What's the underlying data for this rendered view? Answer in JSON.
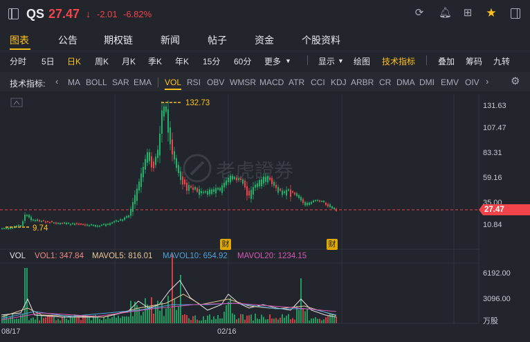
{
  "header": {
    "ticker": "QS",
    "price": "27.47",
    "arrow": "↓",
    "change": "-2.01",
    "change_pct": "-6.82%",
    "icons": [
      "refresh-icon",
      "bell-icon",
      "grid-icon",
      "star-icon",
      "sidebar-icon"
    ]
  },
  "tabs": [
    "图表",
    "公告",
    "期权链",
    "新闻",
    "帖子",
    "资金",
    "个股资料"
  ],
  "periods": [
    "分时",
    "5日",
    "日K",
    "周K",
    "月K",
    "季K",
    "年K",
    "15分",
    "60分",
    "更多"
  ],
  "tools": [
    "显示",
    "绘图",
    "技术指标",
    "叠加",
    "筹码",
    "九转"
  ],
  "indicator_bar": {
    "label": "技术指标:",
    "items": [
      "MA",
      "BOLL",
      "SAR",
      "EMA",
      "VOL",
      "RSI",
      "OBV",
      "WMSR",
      "MACD",
      "ATR",
      "CCI",
      "KDJ",
      "ARBR",
      "CR",
      "DMA",
      "DMI",
      "EMV",
      "OIV"
    ]
  },
  "price_axis": [
    "131.63",
    "107.47",
    "83.31",
    "59.16",
    "35.00",
    "10.84"
  ],
  "current_price_tag": "27.47",
  "high_label": "132.73",
  "low_label": "9.74",
  "watermark": "老虎證券",
  "earnings_markers": [
    "财",
    "财"
  ],
  "volume": {
    "title": "VOL",
    "vol1": "VOL1: 347.84",
    "mavol5": "MAVOL5: 816.01",
    "mavol10": "MAVOL10: 654.92",
    "mavol20": "MAVOL20: 1234.15",
    "axis": [
      "6192.00",
      "3096.00",
      "万股"
    ]
  },
  "x_axis": [
    "08/17",
    "02/16"
  ],
  "colors": {
    "up": "#1fb26a",
    "down": "#f0444a",
    "accent": "#ffc21a",
    "bg": "#22252c"
  }
}
